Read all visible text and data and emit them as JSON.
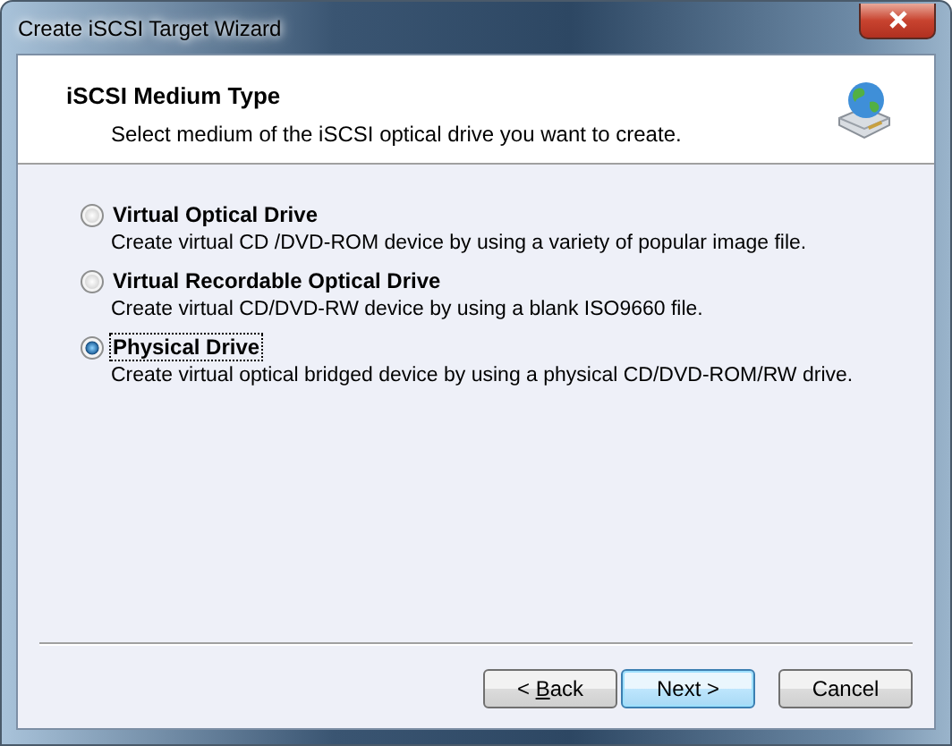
{
  "window": {
    "title": "Create iSCSI Target Wizard"
  },
  "header": {
    "title": "iSCSI Medium Type",
    "subtitle": "Select medium of the iSCSI optical drive you want to create."
  },
  "options": [
    {
      "label": "Virtual Optical Drive",
      "description": "Create virtual CD /DVD-ROM device by using a variety of popular image file.",
      "selected": false
    },
    {
      "label": "Virtual Recordable Optical Drive",
      "description": "Create virtual CD/DVD-RW device by using a blank ISO9660 file.",
      "selected": false
    },
    {
      "label": "Physical Drive",
      "description": "Create virtual optical bridged device by using a physical CD/DVD-ROM/RW drive.",
      "selected": true
    }
  ],
  "buttons": [
    {
      "label": "< ",
      "mnemonic": "B",
      "label_rest": "ack",
      "default": false
    },
    {
      "label": "Next >",
      "default": true
    },
    {
      "label": "Cancel",
      "default": false
    }
  ]
}
